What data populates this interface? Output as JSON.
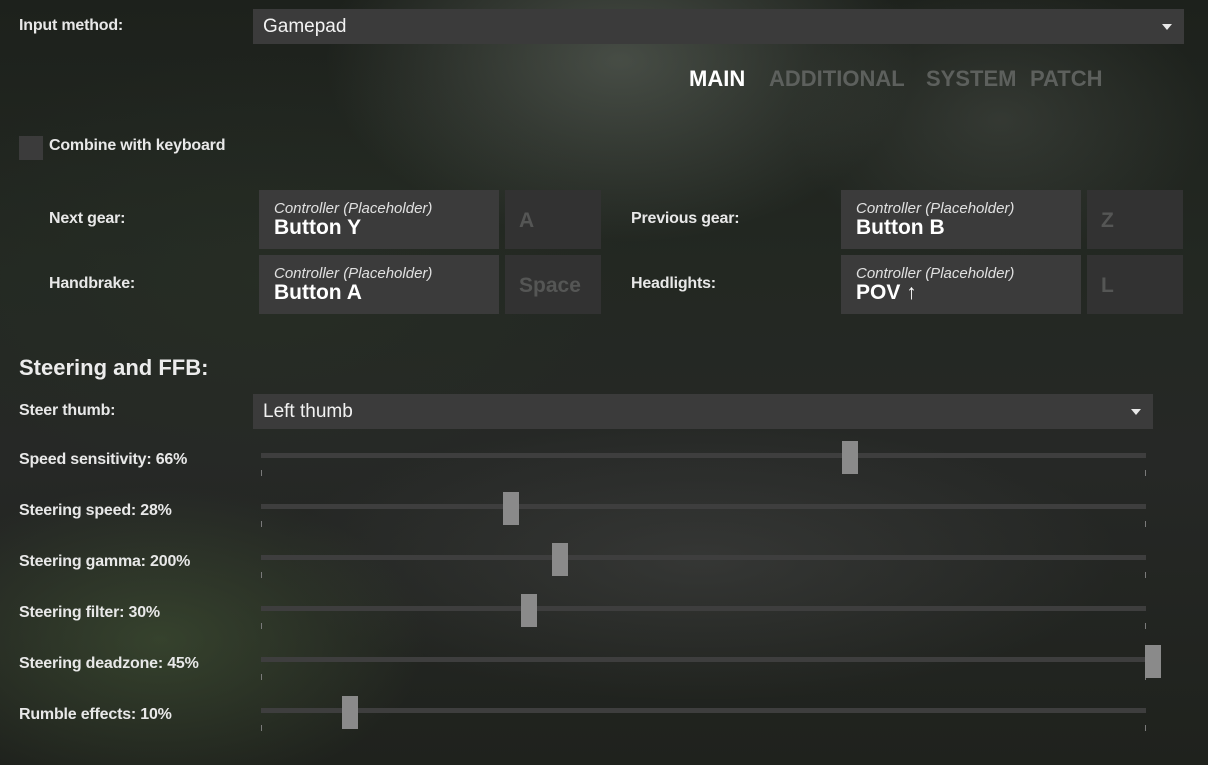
{
  "input_method": {
    "label": "Input method:",
    "value": "Gamepad"
  },
  "tabs": [
    "MAIN",
    "ADDITIONAL",
    "SYSTEM",
    "PATCH"
  ],
  "combine": {
    "label": "Combine with keyboard",
    "checked": false
  },
  "bindings": [
    {
      "label": "Next gear:",
      "device": "Controller (Placeholder)",
      "button": "Button Y",
      "key": "A"
    },
    {
      "label": "Previous gear:",
      "device": "Controller (Placeholder)",
      "button": "Button B",
      "key": "Z"
    },
    {
      "label": "Handbrake:",
      "device": "Controller (Placeholder)",
      "button": "Button A",
      "key": "Space"
    },
    {
      "label": "Headlights:",
      "device": "Controller (Placeholder)",
      "button": "POV ↑",
      "key": "L"
    }
  ],
  "steering": {
    "title": "Steering and FFB:",
    "thumb_label": "Steer thumb:",
    "thumb_value": "Left thumb",
    "sliders": [
      {
        "label": "Speed sensitivity: 66%",
        "value": 0.66
      },
      {
        "label": "Steering speed: 28%",
        "value": 0.28
      },
      {
        "label": "Steering gamma: 200%",
        "value": 0.335
      },
      {
        "label": "Steering filter: 30%",
        "value": 0.3
      },
      {
        "label": "Steering deadzone: 45%",
        "value": 1.0
      },
      {
        "label": "Rumble effects: 10%",
        "value": 0.1
      }
    ]
  },
  "colors": {
    "panel": "#3b3b3b",
    "key_panel": "#323232",
    "tab_inactive": "#5d605d",
    "thumb": "#8a8a8a"
  }
}
